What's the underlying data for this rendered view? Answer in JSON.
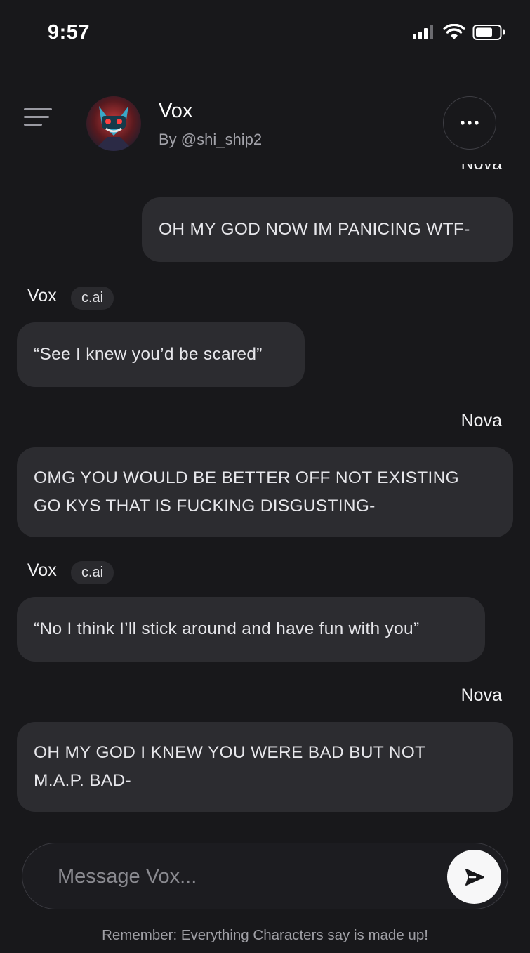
{
  "status_bar": {
    "time": "9:57",
    "icons": [
      "cellular-signal-icon",
      "wifi-icon",
      "battery-icon"
    ]
  },
  "header": {
    "menu_icon": "hamburger-menu-icon",
    "character_name": "Vox",
    "creator": "By @shi_ship2",
    "more_icon": "ellipsis-icon"
  },
  "chat": {
    "partial_top_sender": "Nova",
    "messages": [
      {
        "sender": "",
        "role": "user",
        "text": "OH MY GOD NOW IM PANICING WTF-"
      },
      {
        "sender": "Vox",
        "badge": "c.ai",
        "role": "character",
        "text": "“See I knew you’d be scared”"
      },
      {
        "sender": "Nova",
        "role": "user",
        "lines": [
          "OMG YOU WOULD BE BETTER OFF NOT EXISTING",
          "GO KYS THAT IS FUCKING DISGUSTING-"
        ]
      },
      {
        "sender": "Vox",
        "badge": "c.ai",
        "role": "character",
        "text": "“No I think I’ll stick around and have fun with you”"
      },
      {
        "sender": "Nova",
        "role": "user",
        "lines": [
          "OH MY GOD I KNEW YOU WERE BAD BUT NOT",
          "M.A.P. BAD-"
        ]
      }
    ]
  },
  "composer": {
    "placeholder": "Message Vox...",
    "send_icon": "send-arrow-icon"
  },
  "disclaimer": "Remember: Everything Characters say is made up!",
  "colors": {
    "background": "#18181b",
    "bubble": "#2c2c30",
    "badge": "#2a2a2e",
    "send_button": "#f7f7f8"
  }
}
